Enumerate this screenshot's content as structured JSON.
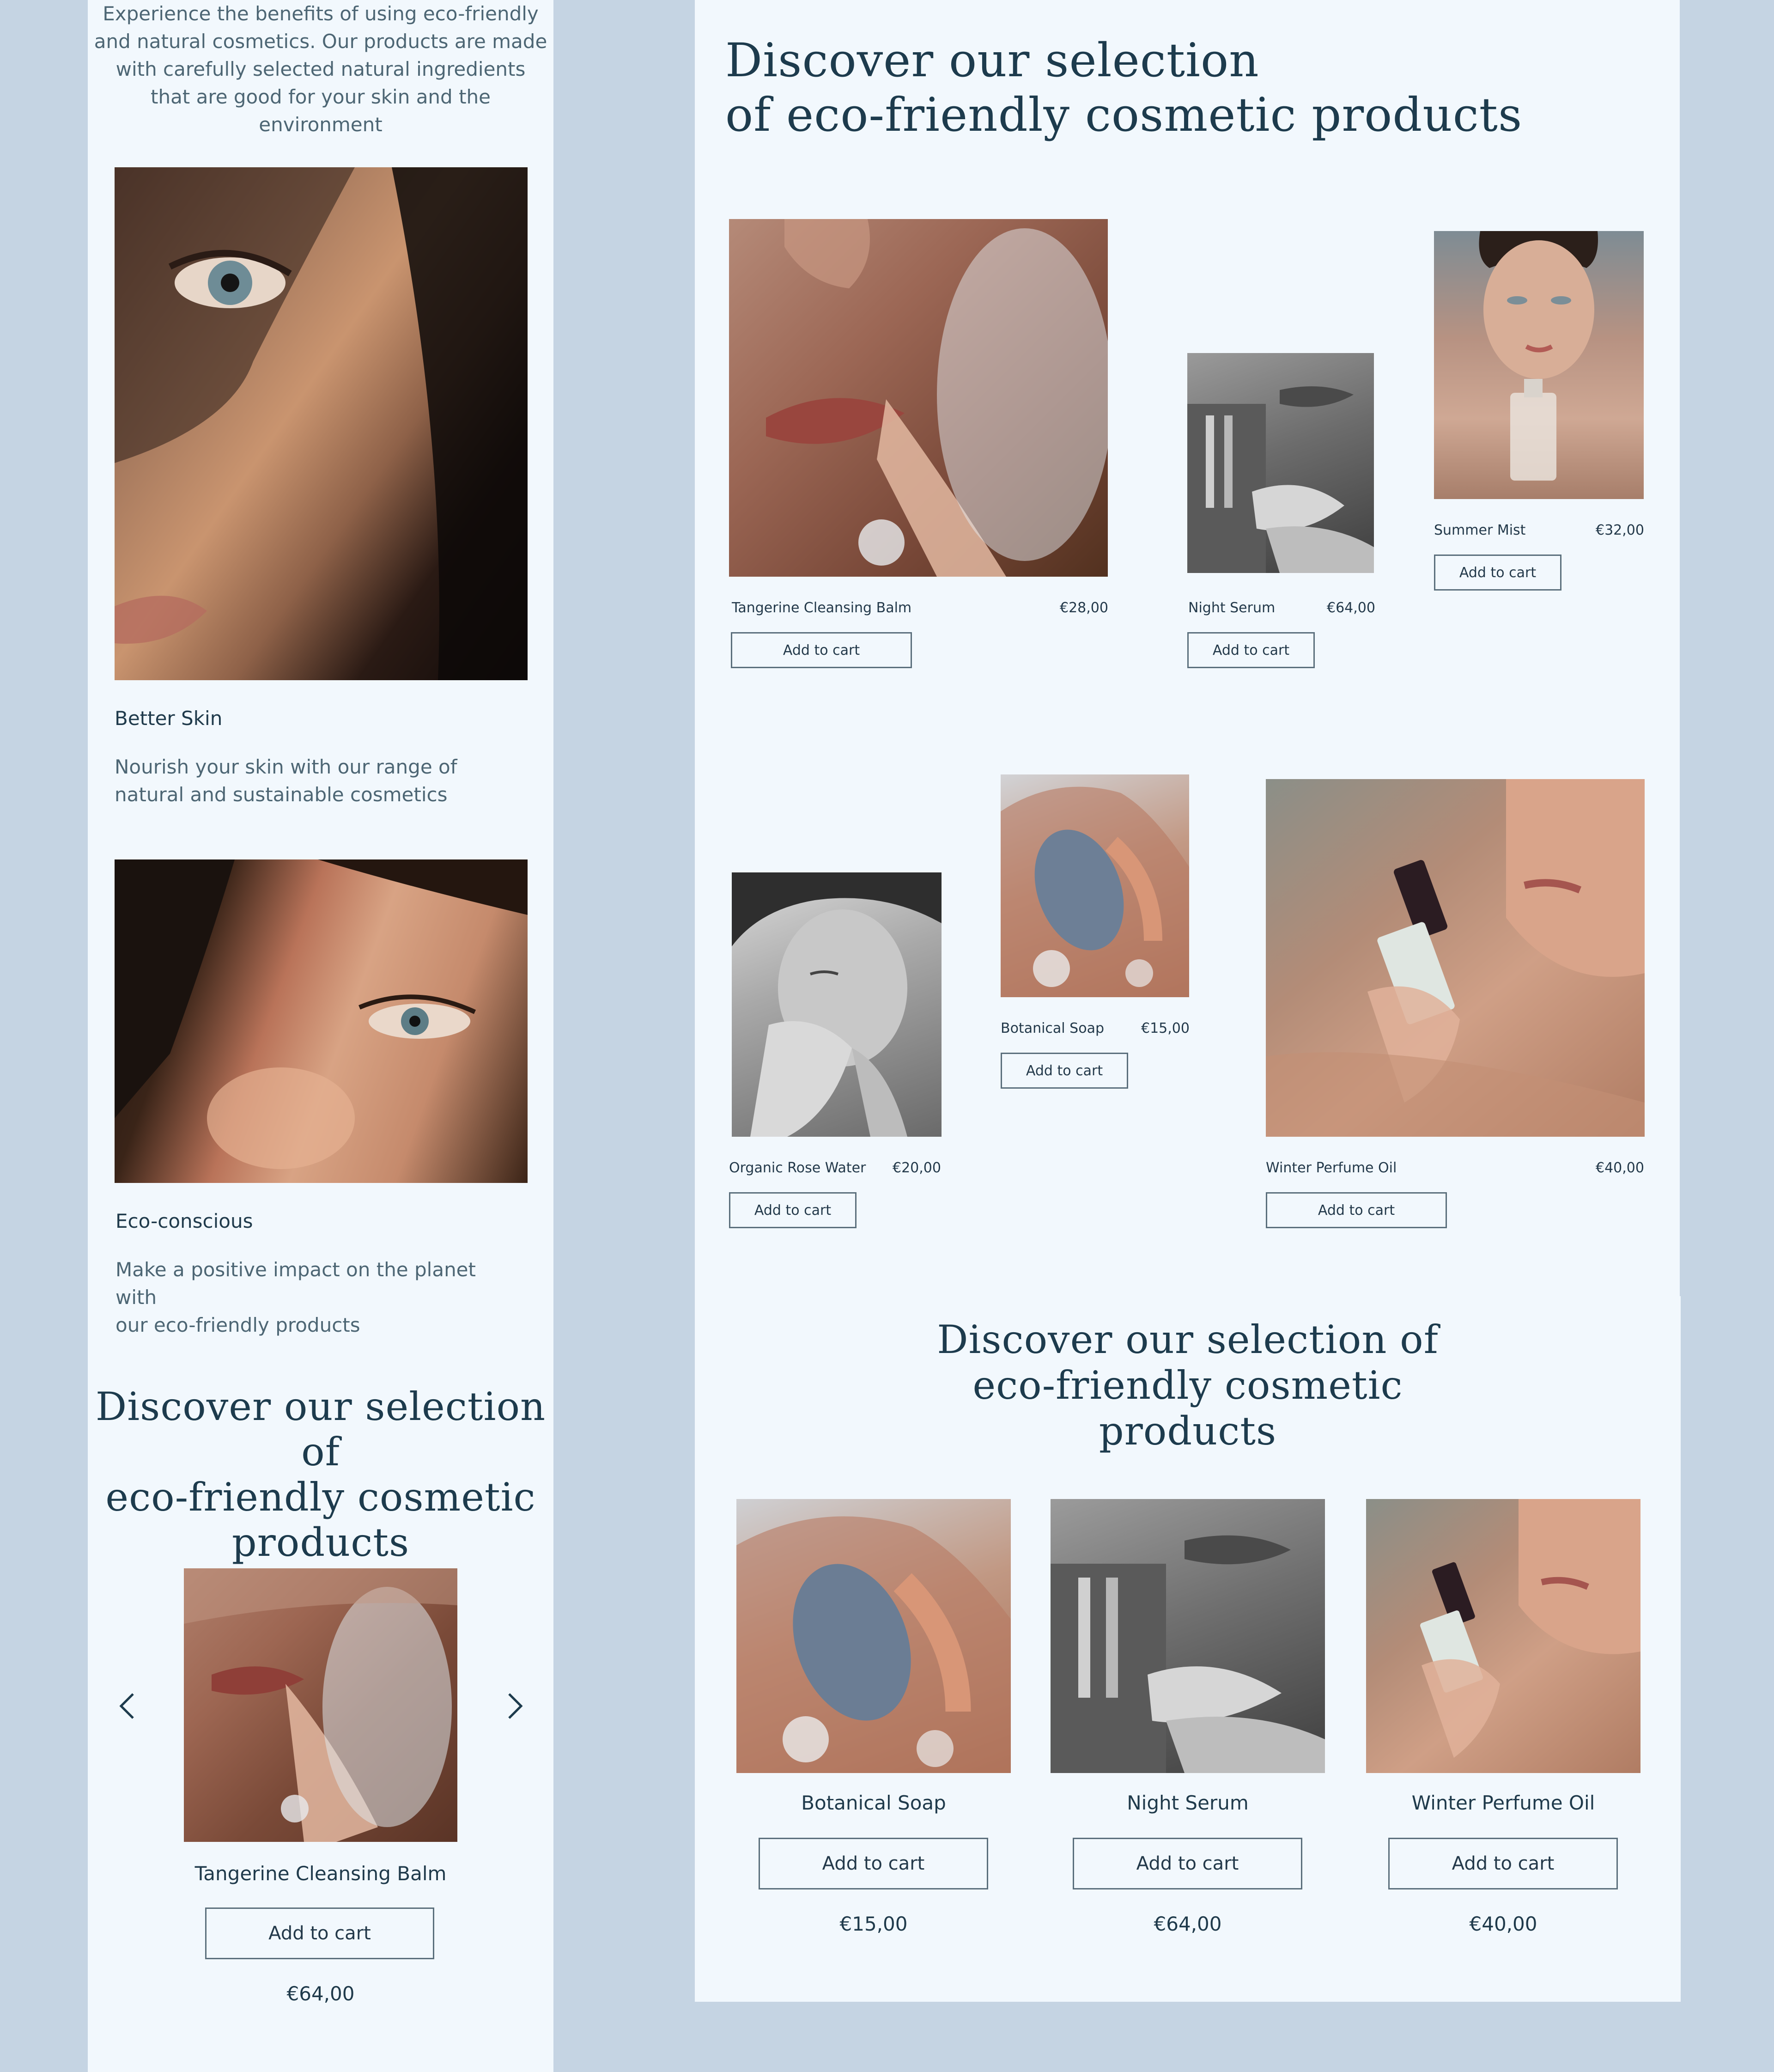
{
  "mobile": {
    "intro": [
      "Experience the benefits of using eco-friendly",
      "and natural cosmetics. Our products are made",
      "with carefully selected natural ingredients",
      "that are good for your skin and the",
      "environment"
    ],
    "features": [
      {
        "title": "Better Skin",
        "text": [
          "Nourish your skin with our range of",
          "natural and sustainable cosmetics"
        ]
      },
      {
        "title": "Eco-conscious",
        "text": [
          "Make a positive impact on the planet with",
          "our eco-friendly products"
        ]
      }
    ],
    "heading": [
      "Discover our selection of",
      "eco-friendly cosmetic",
      "products"
    ],
    "carousel": {
      "name": "Tangerine Cleansing Balm",
      "button": "Add to cart",
      "price": "€64,00"
    }
  },
  "grid_section": {
    "heading": [
      "Discover our selection",
      "of eco-friendly cosmetic products"
    ],
    "products": [
      {
        "name": "Tangerine Cleansing Balm",
        "price": "€28,00",
        "button": "Add to cart"
      },
      {
        "name": "Night Serum",
        "price": "€64,00",
        "button": "Add to cart"
      },
      {
        "name": "Summer Mist",
        "price": "€32,00",
        "button": "Add to cart"
      },
      {
        "name": "Organic Rose Water",
        "price": "€20,00",
        "button": "Add to cart"
      },
      {
        "name": "Botanical Soap",
        "price": "€15,00",
        "button": "Add to cart"
      },
      {
        "name": "Winter Perfume Oil",
        "price": "€40,00",
        "button": "Add to cart"
      }
    ]
  },
  "row_section": {
    "heading": [
      "Discover our selection of",
      "eco-friendly cosmetic",
      "products"
    ],
    "products": [
      {
        "name": "Botanical Soap",
        "button": "Add to cart",
        "price": "€15,00"
      },
      {
        "name": "Night Serum",
        "button": "Add to cart",
        "price": "€64,00"
      },
      {
        "name": "Winter Perfume Oil",
        "button": "Add to cart",
        "price": "€40,00"
      }
    ]
  },
  "icons": {
    "prev": "chevron-left-icon",
    "next": "chevron-right-icon"
  }
}
